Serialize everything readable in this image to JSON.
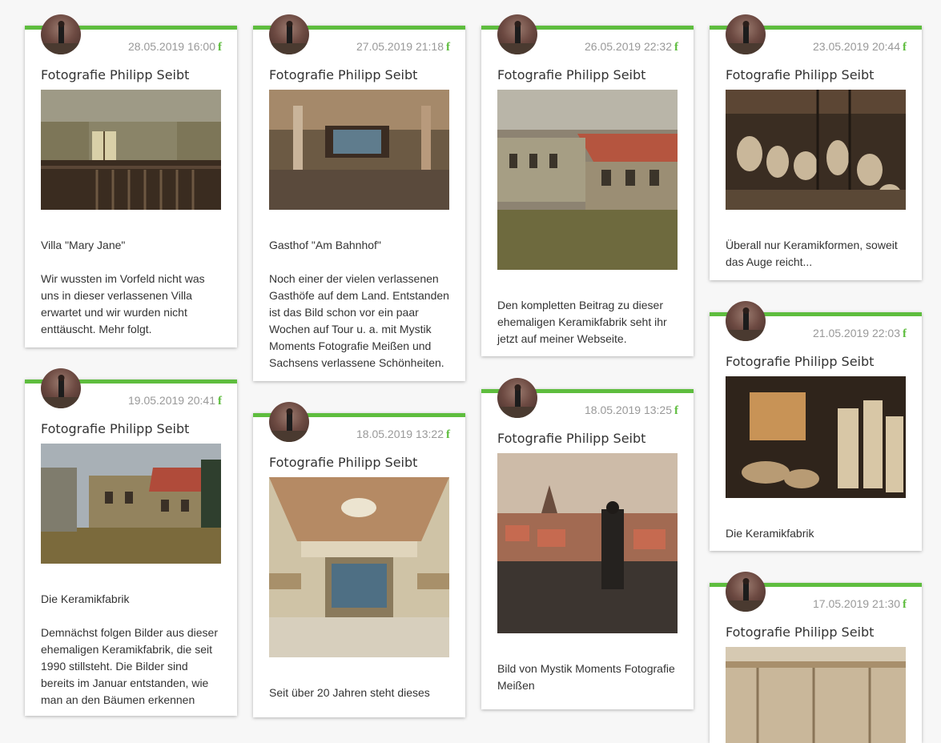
{
  "author": "Fotografie Philipp Seibt",
  "icons": {
    "social": "facebook-icon",
    "avatar": "photographer-avatar"
  },
  "accent_color": "#5ebd3e",
  "posts": [
    {
      "date": "28.05.2019 16:00",
      "image": "villa-staircase-interior",
      "text": "Villa \"Mary Jane\"\n\nWir wussten im Vorfeld nicht was uns in dieser verlassenen Villa erwartet und wir wurden nicht enttäuscht. Mehr folgt."
    },
    {
      "date": "27.05.2019 21:18",
      "image": "abandoned-hall-stage",
      "text": "Gasthof \"Am Bahnhof\"\n\nNoch einer der vielen verlassenen Gasthöfe auf dem Land. Entstanden ist das Bild schon vor ein paar Wochen auf Tour u. a. mit Mystik Moments Fotografie Meißen und Sachsens verlassene Schönheiten."
    },
    {
      "date": "26.05.2019 22:32",
      "image": "derelict-factory-building",
      "text": "Den kompletten Beitrag zu dieser ehemaligen Keramikfabrik seht ihr jetzt auf meiner Webseite."
    },
    {
      "date": "23.05.2019 20:44",
      "image": "ceramic-molds-workshop",
      "text": "Überall nur Keramikformen, soweit das Auge reicht..."
    },
    {
      "date": "21.05.2019 22:03",
      "image": "ceramic-factory-interior",
      "text": "Die Keramikfabrik"
    },
    {
      "date": "19.05.2019 20:41",
      "image": "ceramic-factory-exterior",
      "text": "Die Keramikfabrik\n\nDemnächst folgen Bilder aus dieser ehemaligen Keramikfabrik, die seit 1990 stillsteht. Die Bilder sind bereits im Januar entstanden, wie man an den Bäumen erkennen"
    },
    {
      "date": "18.05.2019 13:22",
      "image": "ornate-ballroom",
      "text": "Seit über 20 Jahren steht dieses"
    },
    {
      "date": "18.05.2019 13:25",
      "image": "photographer-on-rooftop",
      "text": "Bild von Mystik Moments Fotografie Meißen"
    },
    {
      "date": "17.05.2019 21:30",
      "image": "hall-ceiling",
      "text": ""
    }
  ]
}
